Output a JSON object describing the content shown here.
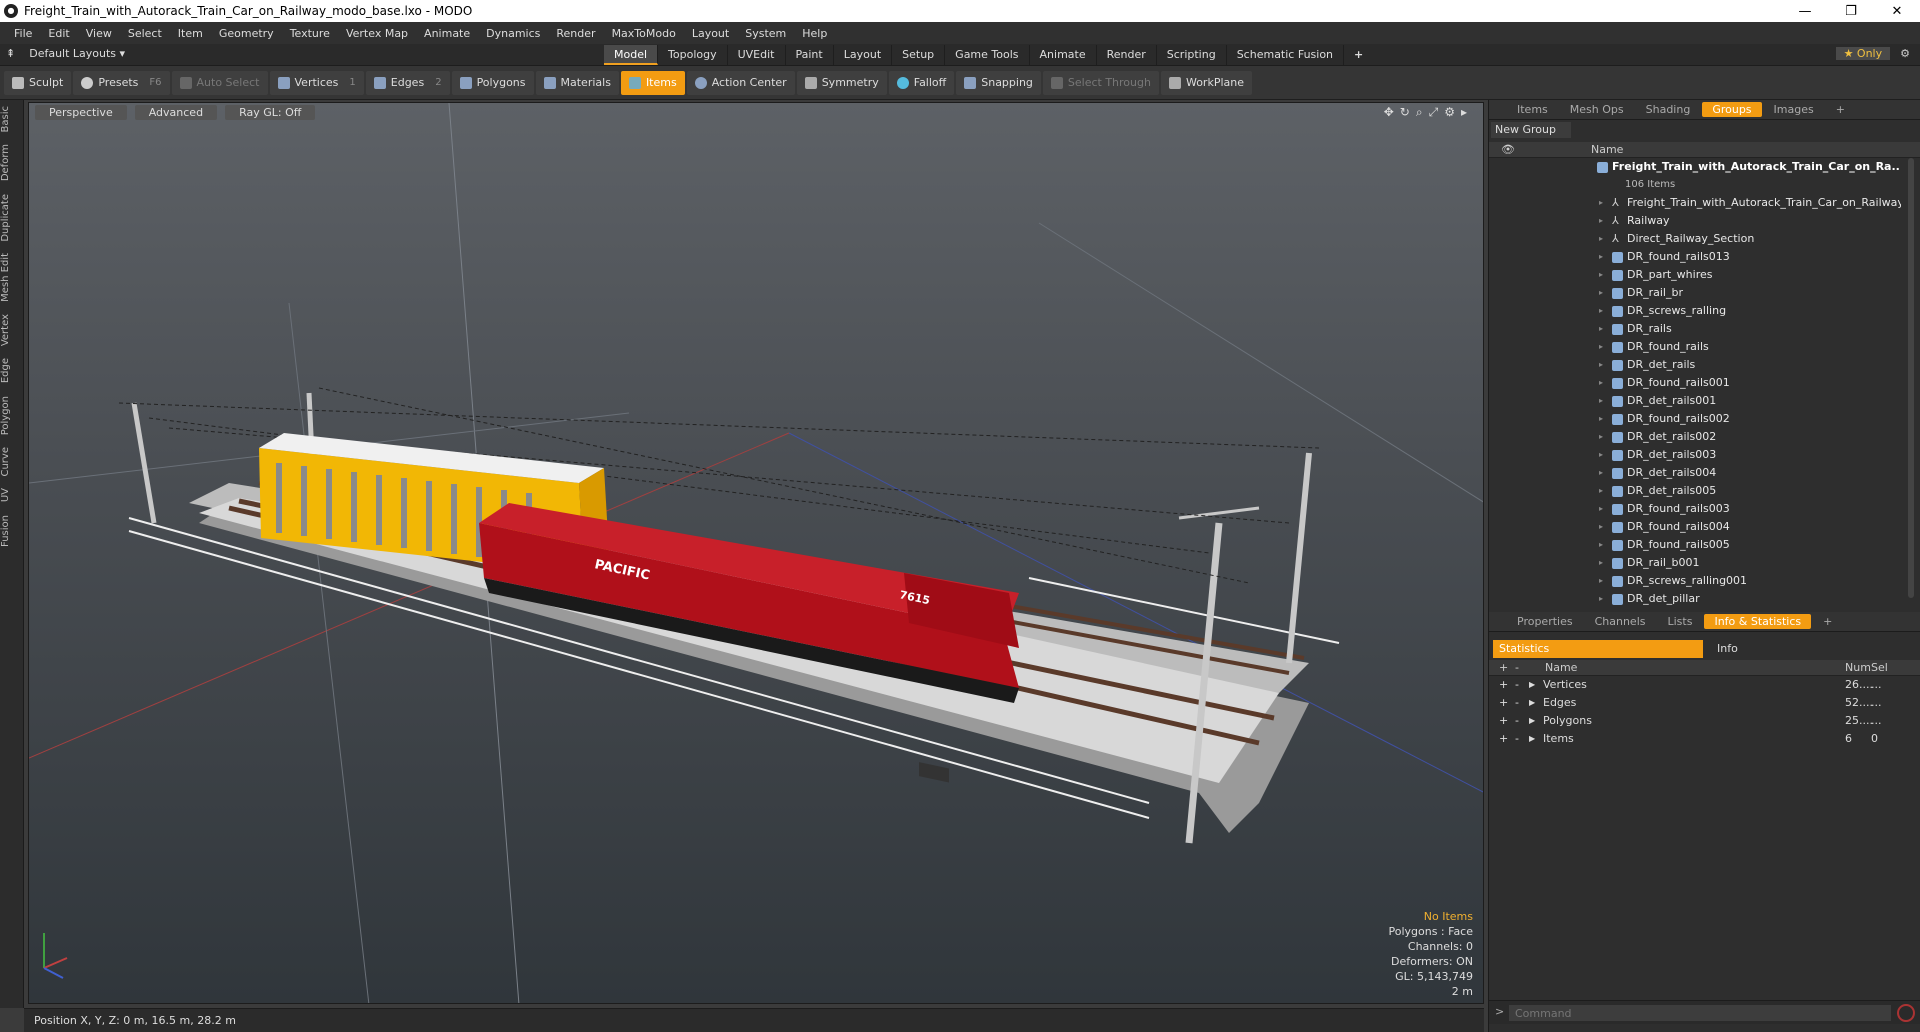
{
  "window": {
    "title": "Freight_Train_with_Autorack_Train_Car_on_Railway_modo_base.lxo - MODO",
    "controls": [
      "—",
      "❐",
      "✕"
    ]
  },
  "menu": [
    "File",
    "Edit",
    "View",
    "Select",
    "Item",
    "Geometry",
    "Texture",
    "Vertex Map",
    "Animate",
    "Dynamics",
    "Render",
    "MaxToModo",
    "Layout",
    "System",
    "Help"
  ],
  "layout": {
    "preset": "Default Layouts ▾",
    "tabs": [
      "Model",
      "Topology",
      "UVEdit",
      "Paint",
      "Layout",
      "Setup",
      "Game Tools",
      "Animate",
      "Render",
      "Scripting",
      "Schematic Fusion"
    ],
    "active_tab": "Model",
    "add": "+",
    "only": "★ Only",
    "gear": "⚙"
  },
  "toolbar": {
    "sculpt": "Sculpt",
    "presets": "Presets",
    "presets_key": "F6",
    "auto_select": "Auto Select",
    "vertices": "Vertices",
    "vertices_key": "1",
    "edges": "Edges",
    "edges_key": "2",
    "polygons": "Polygons",
    "materials": "Materials",
    "items": "Items",
    "action_center": "Action Center",
    "symmetry": "Symmetry",
    "falloff": "Falloff",
    "snapping": "Snapping",
    "select_through": "Select Through",
    "workplane": "WorkPlane"
  },
  "left_tabs": [
    "Basic",
    "Deform",
    "Duplicate",
    "Mesh Edit",
    "Vertex",
    "Edge",
    "Polygon",
    "Curve",
    "UV",
    "Fusion"
  ],
  "viewport": {
    "view": "Perspective",
    "shading": "Advanced",
    "raygl": "Ray GL: Off",
    "info": {
      "no_items": "No Items",
      "polygons": "Polygons : Face",
      "channels": "Channels: 0",
      "deformers": "Deformers: ON",
      "gl": "GL: 5,143,749",
      "scale": "2 m"
    },
    "loco_name": "PACIFIC",
    "loco_number": "7615"
  },
  "status": {
    "position": "Position X, Y, Z:  0 m, 16.5 m, 28.2 m"
  },
  "right_tabs_top": {
    "tabs": [
      "Items",
      "Mesh Ops",
      "Shading",
      "Groups",
      "Images"
    ],
    "active": "Groups"
  },
  "groups": {
    "new_group": "New Group",
    "col_name": "Name",
    "root": "Freight_Train_with_Autorack_Train_Car_on_Ra...",
    "root_count": "106 Items",
    "items": [
      {
        "name": "Freight_Train_with_Autorack_Train_Car_on_Railway",
        "icon": "locator-icon"
      },
      {
        "name": "Railway",
        "icon": "locator-icon"
      },
      {
        "name": "Direct_Railway_Section",
        "icon": "locator-icon"
      },
      {
        "name": "DR_found_rails013",
        "icon": "mesh-icon"
      },
      {
        "name": "DR_part_whires",
        "icon": "mesh-icon"
      },
      {
        "name": "DR_rail_br",
        "icon": "mesh-icon"
      },
      {
        "name": "DR_screws_ralling",
        "icon": "mesh-icon"
      },
      {
        "name": "DR_rails",
        "icon": "mesh-icon"
      },
      {
        "name": "DR_found_rails",
        "icon": "mesh-icon"
      },
      {
        "name": "DR_det_rails",
        "icon": "mesh-icon"
      },
      {
        "name": "DR_found_rails001",
        "icon": "mesh-icon"
      },
      {
        "name": "DR_det_rails001",
        "icon": "mesh-icon"
      },
      {
        "name": "DR_found_rails002",
        "icon": "mesh-icon"
      },
      {
        "name": "DR_det_rails002",
        "icon": "mesh-icon"
      },
      {
        "name": "DR_det_rails003",
        "icon": "mesh-icon"
      },
      {
        "name": "DR_det_rails004",
        "icon": "mesh-icon"
      },
      {
        "name": "DR_det_rails005",
        "icon": "mesh-icon"
      },
      {
        "name": "DR_found_rails003",
        "icon": "mesh-icon"
      },
      {
        "name": "DR_found_rails004",
        "icon": "mesh-icon"
      },
      {
        "name": "DR_found_rails005",
        "icon": "mesh-icon"
      },
      {
        "name": "DR_rail_b001",
        "icon": "mesh-icon"
      },
      {
        "name": "DR_screws_ralling001",
        "icon": "mesh-icon"
      },
      {
        "name": "DR_det_pillar",
        "icon": "mesh-icon"
      }
    ]
  },
  "right_tabs_bottom": {
    "tabs": [
      "Properties",
      "Channels",
      "Lists",
      "Info & Statistics"
    ],
    "active": "Info & Statistics"
  },
  "stats": {
    "tab_statistics": "Statistics",
    "tab_info": "Info",
    "col_name": "Name",
    "col_num": "Num",
    "col_sel": "Sel",
    "rows": [
      {
        "name": "Vertices",
        "num": "26....",
        "sel": "..."
      },
      {
        "name": "Edges",
        "num": "52....",
        "sel": "..."
      },
      {
        "name": "Polygons",
        "num": "25....",
        "sel": "..."
      },
      {
        "name": "Items",
        "num": "6",
        "sel": "0"
      }
    ]
  },
  "command": {
    "placeholder": "Command"
  },
  "colors": {
    "accent": "#f39c12",
    "loco_red": "#b0101a",
    "autorack_yellow": "#f2b705"
  }
}
